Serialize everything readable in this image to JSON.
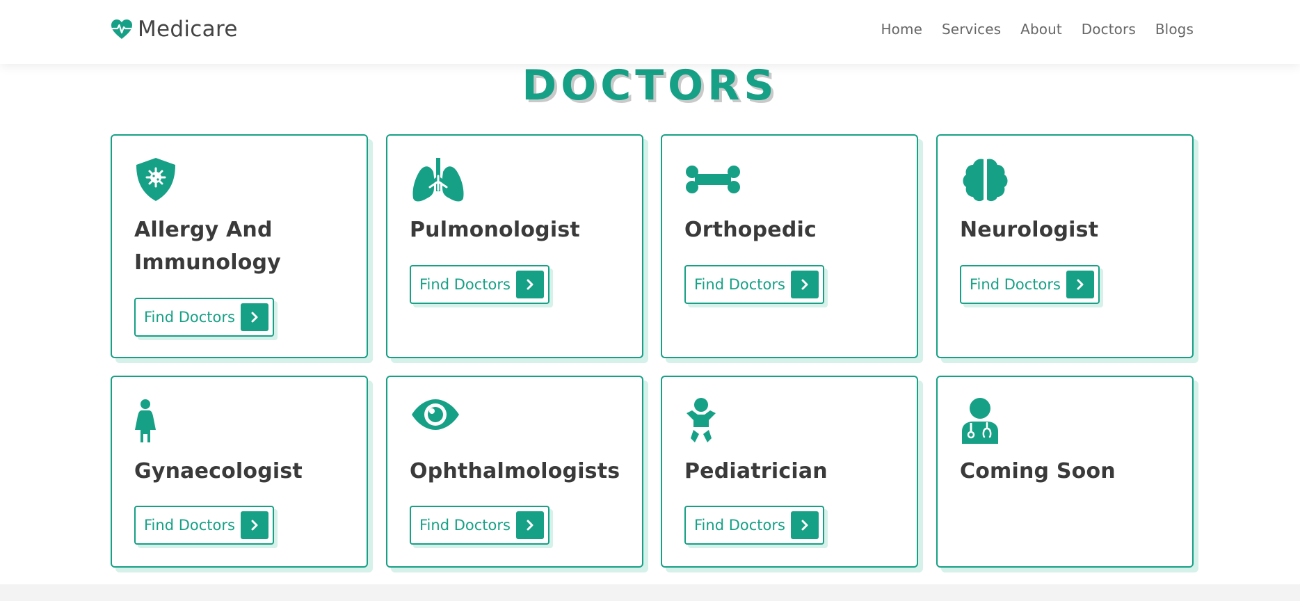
{
  "brand": {
    "name": "Medicare",
    "icon": "heart-pulse-icon",
    "accent": "#16a085"
  },
  "nav": {
    "items": [
      "Home",
      "Services",
      "About",
      "Doctors",
      "Blogs"
    ]
  },
  "section": {
    "title": "DOCTORS"
  },
  "cards": [
    {
      "title": "Allergy And Immunology",
      "icon": "shield-virus-icon",
      "button": "Find Doctors"
    },
    {
      "title": "Pulmonologist",
      "icon": "lungs-icon",
      "button": "Find Doctors"
    },
    {
      "title": "Orthopedic",
      "icon": "bone-icon",
      "button": "Find Doctors"
    },
    {
      "title": "Neurologist",
      "icon": "brain-icon",
      "button": "Find Doctors"
    },
    {
      "title": "Gynaecologist",
      "icon": "female-icon",
      "button": "Find Doctors"
    },
    {
      "title": "Ophthalmologists",
      "icon": "eye-icon",
      "button": "Find Doctors"
    },
    {
      "title": "Pediatrician",
      "icon": "baby-icon",
      "button": "Find Doctors"
    },
    {
      "title": "Coming Soon",
      "icon": "user-doctor-icon"
    }
  ]
}
